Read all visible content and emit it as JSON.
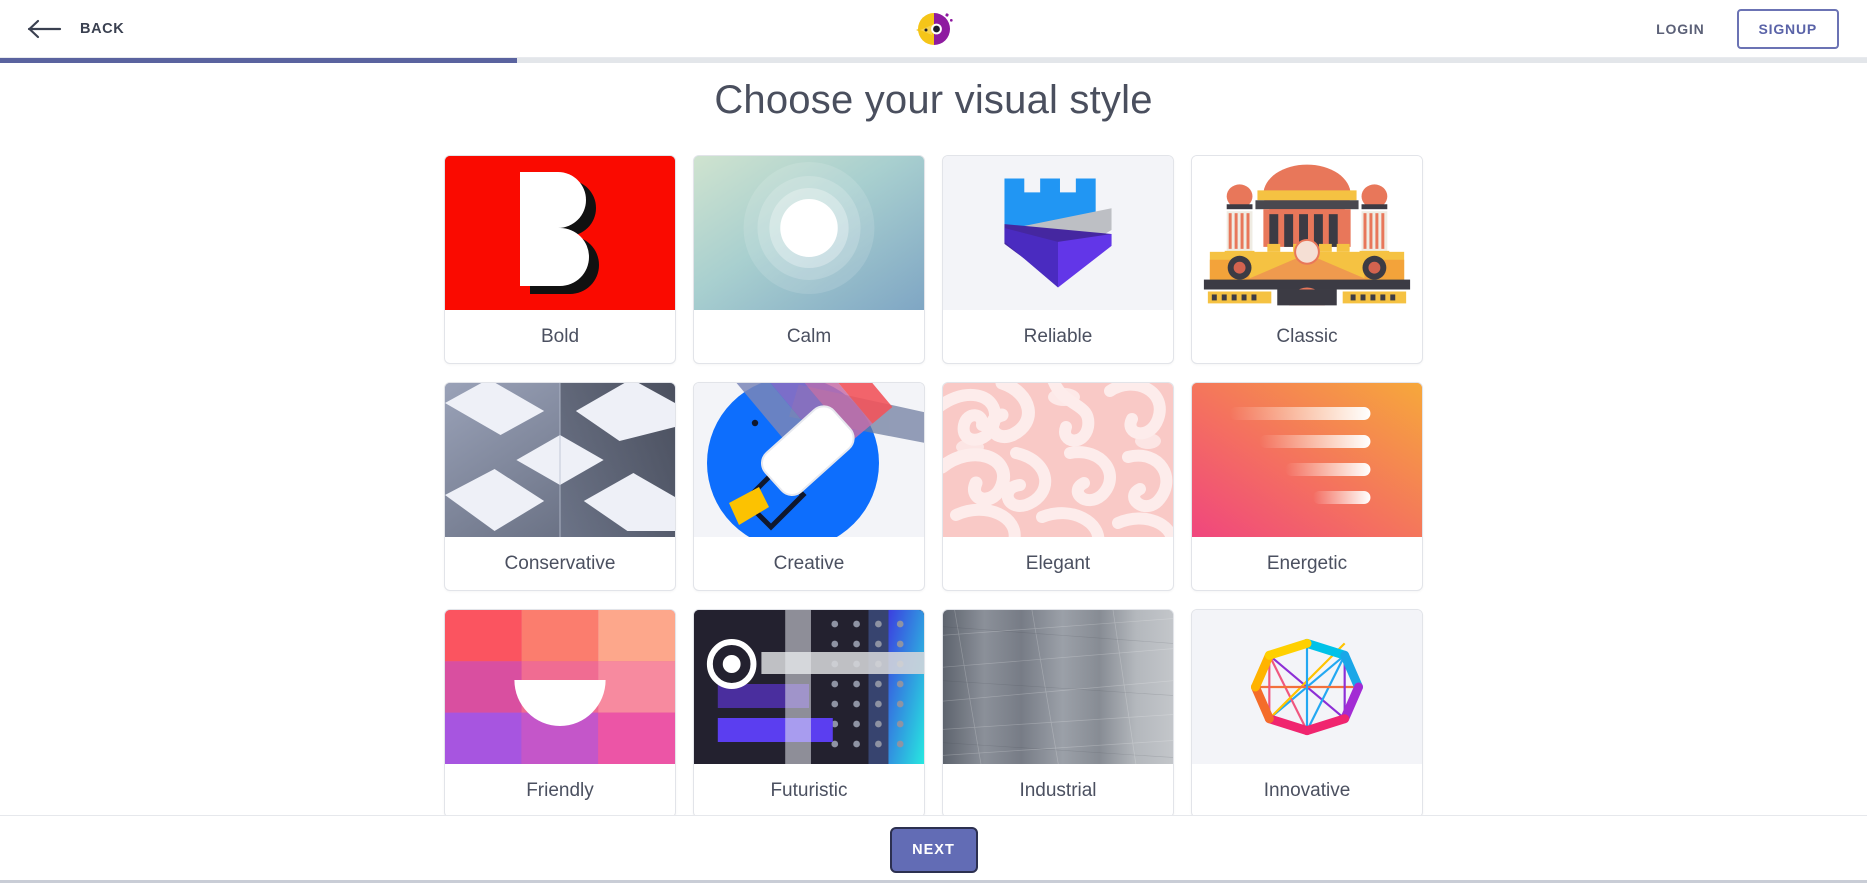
{
  "header": {
    "back_label": "BACK",
    "back_icon": "arrow-left-icon",
    "logo_icon": "parrot-logo-icon",
    "login_label": "LOGIN",
    "signup_label": "SIGNUP"
  },
  "progress": {
    "percent": 27.7,
    "fill_color": "#5a639f",
    "track_color": "#e3e6ea"
  },
  "main": {
    "title": "Choose your visual style",
    "styles": [
      {
        "label": "Bold",
        "art": "bold-letter-b-art",
        "bg": "#fa0a00"
      },
      {
        "label": "Calm",
        "art": "calm-sun-circles-art",
        "bg": "#a9cfc8"
      },
      {
        "label": "Reliable",
        "art": "reliable-castle-shield-art",
        "bg": "#f3f4f8"
      },
      {
        "label": "Classic",
        "art": "classic-building-art",
        "bg": "#ffffff"
      },
      {
        "label": "Conservative",
        "art": "conservative-isometric-art",
        "bg": "#7b8399"
      },
      {
        "label": "Creative",
        "art": "creative-paint-roller-art",
        "bg": "#f3f4f8"
      },
      {
        "label": "Elegant",
        "art": "elegant-damask-art",
        "bg": "#fadcda"
      },
      {
        "label": "Energetic",
        "art": "energetic-speed-lines-art",
        "bg": "#f58a5e"
      },
      {
        "label": "Friendly",
        "art": "friendly-color-grid-art",
        "bg": "#e8609a"
      },
      {
        "label": "Futuristic",
        "art": "futuristic-tech-grid-art",
        "bg": "#23212f"
      },
      {
        "label": "Industrial",
        "art": "industrial-metal-art",
        "bg": "#a9adb2"
      },
      {
        "label": "Innovative",
        "art": "innovative-hexagon-art",
        "bg": "#f3f4f8"
      }
    ]
  },
  "footer": {
    "next_label": "NEXT",
    "next_color": "#626cb5"
  }
}
